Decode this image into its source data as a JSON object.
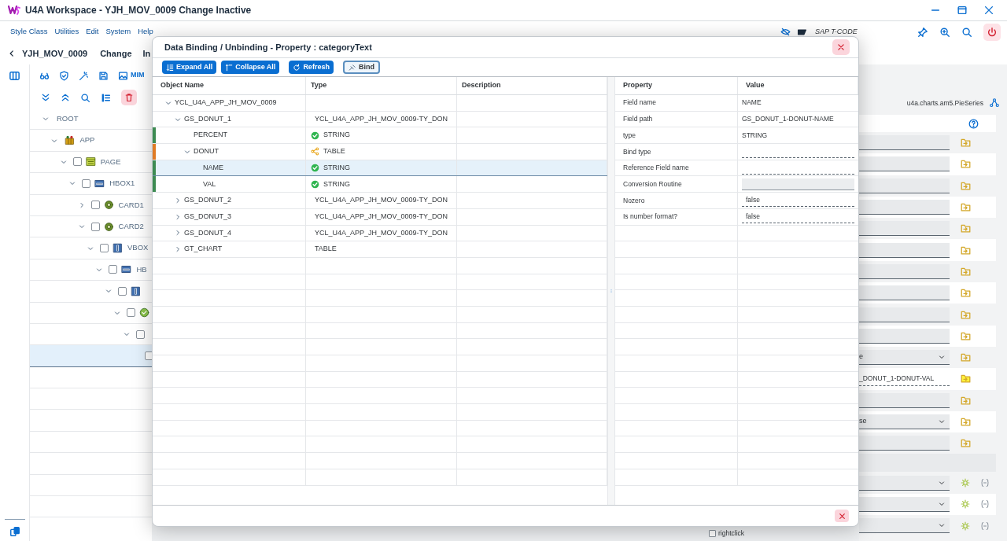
{
  "window": {
    "title": "U4A Workspace - YJH_MOV_0009 Change Inactive"
  },
  "menu": [
    "Style Class",
    "Utilities",
    "Edit",
    "System",
    "Help"
  ],
  "tcode": "SAP T-CODE",
  "header": {
    "app": "YJH_MOV_0009",
    "mode": "Change",
    "status": "In"
  },
  "toolbar": {
    "image_label": "MIM"
  },
  "tree": [
    {
      "label": "ROOT",
      "expanded": true,
      "selected": false,
      "children": [
        {
          "label": "APP",
          "kind": "app",
          "expanded": true,
          "selected": false,
          "children": [
            {
              "label": "PAGE",
              "kind": "page",
              "checked": false,
              "expanded": true,
              "selected": false,
              "children": [
                {
                  "label": "HBOX1",
                  "kind": "hbox",
                  "checked": false,
                  "expanded": true,
                  "selected": false,
                  "children": [
                    {
                      "label": "CARD1",
                      "kind": "card",
                      "checked": false,
                      "expanded": false,
                      "selected": false
                    },
                    {
                      "label": "CARD2",
                      "kind": "card",
                      "checked": false,
                      "expanded": true,
                      "selected": false,
                      "children": [
                        {
                          "label": "VBOX",
                          "kind": "vbox",
                          "checked": false,
                          "expanded": true,
                          "selected": false,
                          "children": [
                            {
                              "label": "HB",
                              "kind": "hbox",
                              "checked": false,
                              "expanded": true,
                              "selected": false,
                              "children": [
                                {
                                  "kind": "vbox",
                                  "checked": false,
                                  "expanded": true,
                                  "selected": false,
                                  "children": [
                                    {
                                      "kind": "control",
                                      "checked": false,
                                      "expanded": true,
                                      "selected": false,
                                      "children": [
                                        {
                                          "checked": false,
                                          "expanded": true,
                                          "selected": false,
                                          "children": [
                                            {
                                              "checked": false,
                                              "selected": true
                                            }
                                          ]
                                        }
                                      ]
                                    }
                                  ]
                                }
                              ]
                            }
                          ]
                        }
                      ]
                    }
                  ]
                }
              ]
            }
          ]
        }
      ]
    }
  ],
  "dialog": {
    "title": "Data Binding / Unbinding - Property : categoryText",
    "buttons": [
      {
        "label": "Expand All",
        "kind": "expand"
      },
      {
        "label": "Collapse All",
        "kind": "collapse"
      },
      {
        "label": "Refresh",
        "kind": "refresh"
      },
      {
        "label": "Bind",
        "kind": "bind"
      }
    ],
    "columns": [
      "Object Name",
      "Type",
      "Description"
    ],
    "objects": [
      {
        "name": "YCL_U4A_APP_JH_MOV_0009",
        "expanded": true,
        "selected": false,
        "children": [
          {
            "name": "GS_DONUT_1",
            "type": "YCL_U4A_APP_JH_MOV_0009-TY_DON",
            "expanded": true,
            "selected": false,
            "children": [
              {
                "name": "PERCENT",
                "type": "STRING",
                "kind": "field",
                "color": "#3d8b52",
                "selected": false
              },
              {
                "name": "DONUT",
                "type": "TABLE",
                "kind": "table",
                "color": "#e07b25",
                "expanded": true,
                "selected": false,
                "children": [
                  {
                    "name": "NAME",
                    "type": "STRING",
                    "kind": "field",
                    "color": "#3d8b52",
                    "selected": true
                  },
                  {
                    "name": "VAL",
                    "type": "STRING",
                    "kind": "field",
                    "color": "#3d8b52",
                    "selected": false
                  }
                ]
              }
            ]
          },
          {
            "name": "GS_DONUT_2",
            "type": "YCL_U4A_APP_JH_MOV_0009-TY_DON",
            "expanded": false,
            "selected": false
          },
          {
            "name": "GS_DONUT_3",
            "type": "YCL_U4A_APP_JH_MOV_0009-TY_DON",
            "expanded": false,
            "selected": false
          },
          {
            "name": "GS_DONUT_4",
            "type": "YCL_U4A_APP_JH_MOV_0009-TY_DON",
            "expanded": false,
            "selected": false
          },
          {
            "name": "GT_CHART",
            "type": "TABLE",
            "expanded": false,
            "selected": false
          }
        ]
      }
    ],
    "prop_columns": [
      "Property",
      "Value"
    ],
    "properties": [
      {
        "property": "Field name",
        "value": "NAME",
        "kind": "text"
      },
      {
        "property": "Field path",
        "value": "GS_DONUT_1-DONUT-NAME",
        "kind": "text"
      },
      {
        "property": "type",
        "value": "STRING",
        "kind": "text"
      },
      {
        "property": "Bind type",
        "kind": "field"
      },
      {
        "property": "Reference Field name",
        "kind": "field"
      },
      {
        "property": "Conversion Routine",
        "kind": "readonly"
      },
      {
        "property": "Nozero",
        "value": "false",
        "kind": "field"
      },
      {
        "property": "Is number format?",
        "value": "false",
        "kind": "field"
      }
    ]
  },
  "panel": {
    "class_name": "u4a.charts.am5.PieSeries",
    "rows": [
      {
        "kind": "field"
      },
      {
        "kind": "field"
      },
      {
        "kind": "field"
      },
      {
        "kind": "field"
      },
      {
        "kind": "field"
      },
      {
        "kind": "field"
      },
      {
        "kind": "field"
      },
      {
        "kind": "field"
      },
      {
        "kind": "field"
      },
      {
        "kind": "field"
      },
      {
        "kind": "select",
        "value": "e"
      },
      {
        "kind": "bound",
        "value": "_DONUT_1-DONUT-VAL"
      },
      {
        "kind": "field"
      },
      {
        "kind": "select",
        "value": "se"
      },
      {
        "kind": "field"
      },
      {
        "kind": "group"
      },
      {
        "kind": "event"
      },
      {
        "kind": "event"
      },
      {
        "kind": "event"
      }
    ]
  },
  "footer_option": {
    "label": "rightclick",
    "checked": false
  }
}
